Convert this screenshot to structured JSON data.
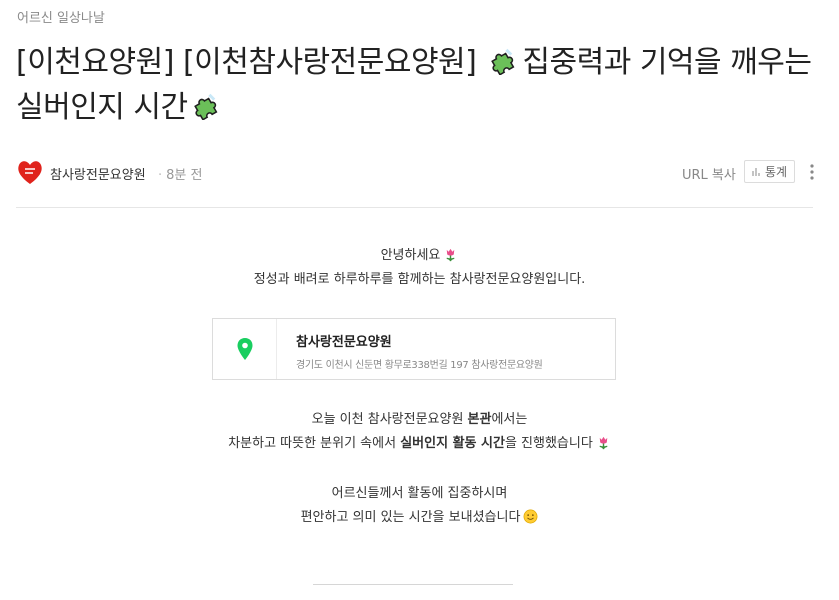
{
  "category": "어르신 일상나날",
  "post": {
    "title_part1": "[이천요양원] [이천참사랑전문요양원] ",
    "title_part2": "집중력과 기억을 깨우는 실버인지 시간"
  },
  "author": {
    "name": "참사랑전문요양원",
    "time": "8분 전",
    "url_copy_label": "URL 복사",
    "stats_label": "통계"
  },
  "content": {
    "greeting_line1": "안녕하세요",
    "greeting_line2": "정성과 배려로 하루하루를 함께하는 참사랑전문요양원입니다.",
    "place": {
      "name": "참사랑전문요양원",
      "address": "경기도 이천시 신둔면 황무로338번길 197 참사랑전문요양원"
    },
    "para2_line1_a": "오늘 이천 참사랑전문요양원 ",
    "para2_line1_b": "본관",
    "para2_line1_c": "에서는",
    "para2_line2_a": "차분하고 따뜻한 분위기 속에서 ",
    "para2_line2_b": "실버인지 활동 시간",
    "para2_line2_c": "을 진행했습니다",
    "para3_line1": "어르신들께서 활동에 집중하시며",
    "para3_line2": "편안하고 의미 있는 시간을 보내셨습니다"
  },
  "icons": {
    "puzzle": "puzzle-piece-icon",
    "tulip": "tulip-icon",
    "smile": "smiling-face-icon",
    "map_pin": "map-pin-icon"
  },
  "colors": {
    "accent_green": "#19ce60",
    "puzzle_green": "#5cb85c"
  }
}
